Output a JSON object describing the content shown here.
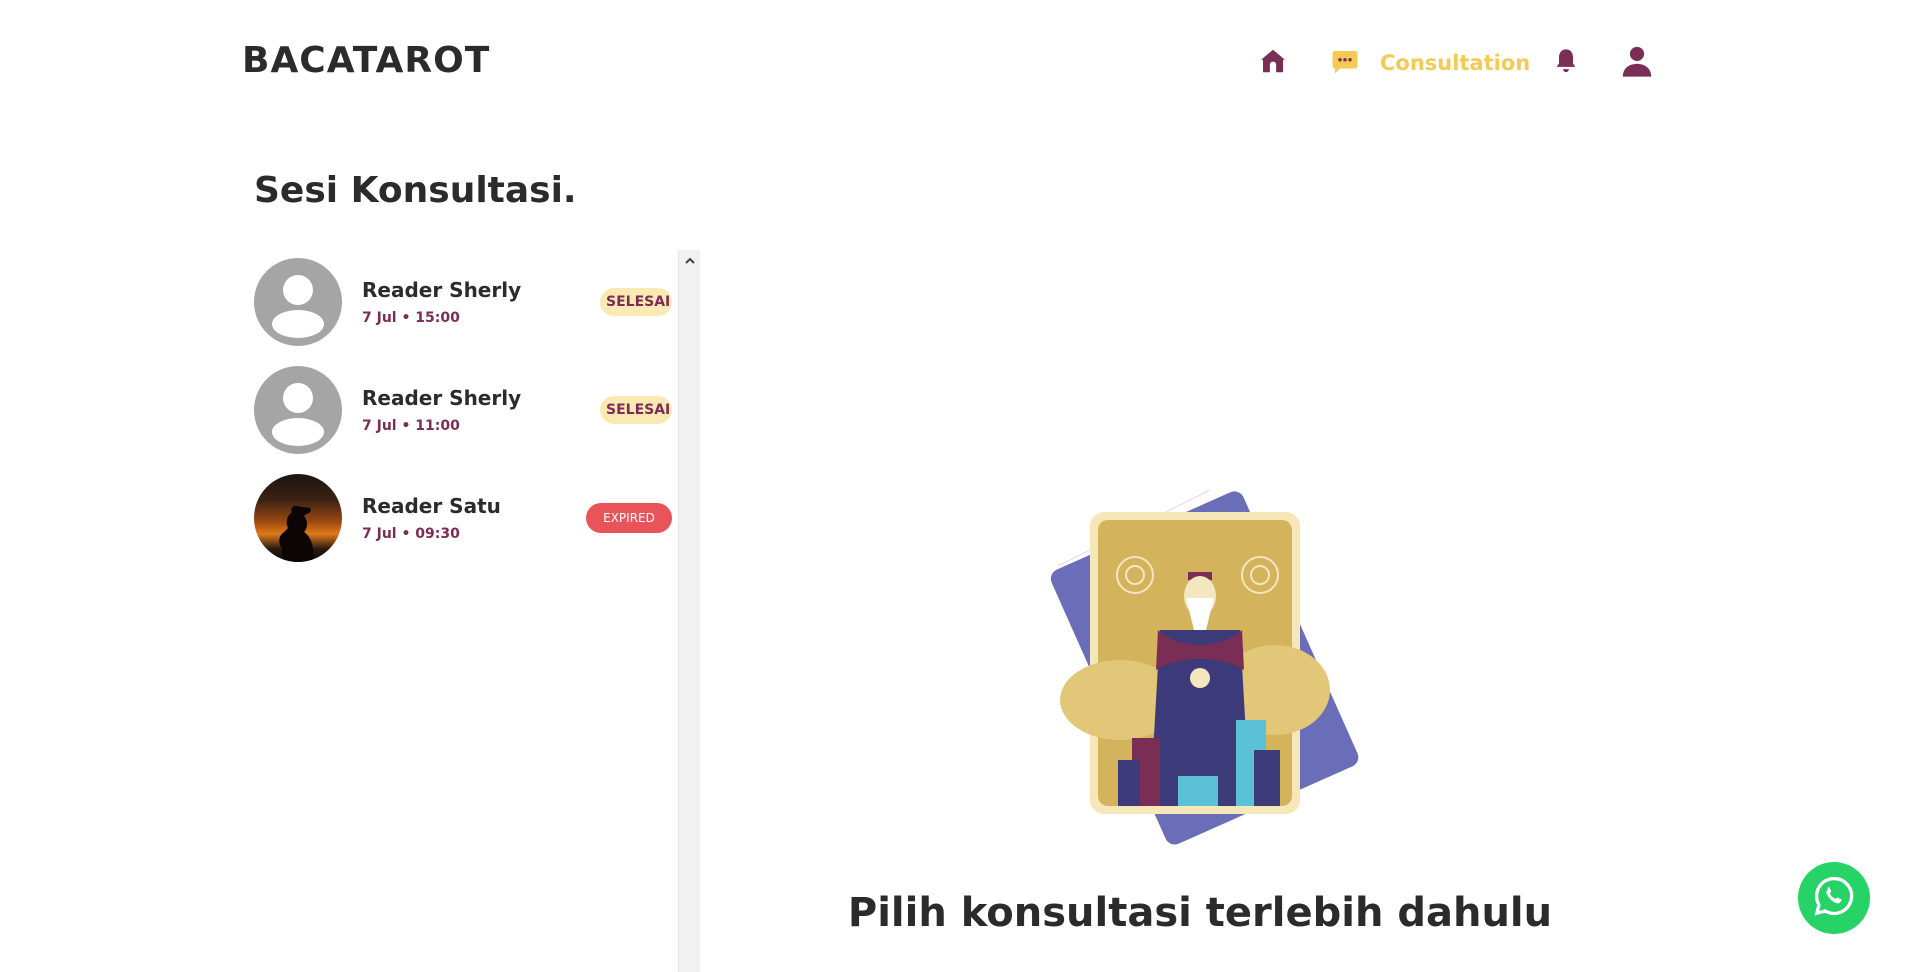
{
  "header": {
    "logo": "BACATAROT",
    "nav": {
      "home_icon": "home-icon",
      "consultation_icon": "chat-bubble-icon",
      "consultation_label": "Consultation",
      "notification_icon": "bell-icon",
      "profile_icon": "user-icon"
    }
  },
  "sessions": {
    "title": "Sesi Konsultasi.",
    "items": [
      {
        "name": "Reader Sherly",
        "time": "7 Jul • 15:00",
        "status": "SELESAI",
        "avatar": "default-avatar"
      },
      {
        "name": "Reader Sherly",
        "time": "7 Jul • 11:00",
        "status": "SELESAI",
        "avatar": "default-avatar"
      },
      {
        "name": "Reader Satu",
        "time": "7 Jul • 09:30",
        "status": "EXPIRED",
        "avatar": "photo-avatar"
      }
    ]
  },
  "main": {
    "empty_message": "Pilih konsultasi terlebih dahulu",
    "illustration": "tarot-card-illustration"
  },
  "floating": {
    "whatsapp_icon": "whatsapp-icon"
  },
  "colors": {
    "accent_yellow": "#f3cb54",
    "brand_plum": "#7a2d55",
    "badge_done_bg": "#fbe9b4",
    "badge_expired_bg": "#e9545a",
    "whatsapp_green": "#25d366"
  }
}
